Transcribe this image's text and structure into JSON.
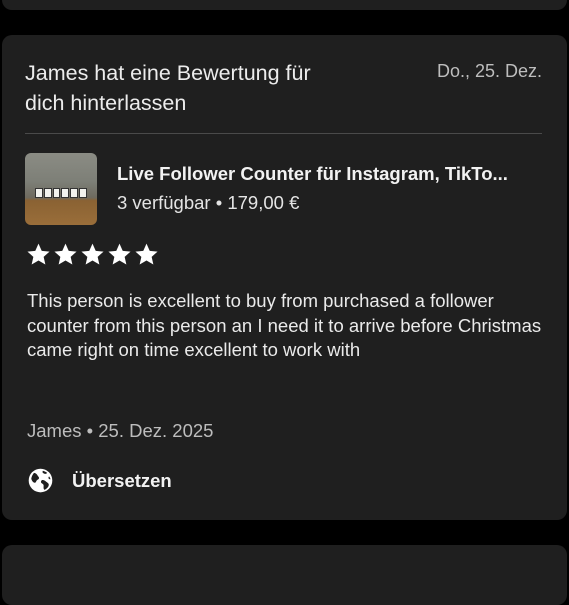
{
  "notification": {
    "title": "James hat eine Bewertung für dich hinterlassen",
    "date": "Do., 25. Dez."
  },
  "product": {
    "title": "Live Follower Counter für Instagram, TikTo...",
    "availability": "3 verfügbar",
    "separator": "•",
    "price": "179,00 €"
  },
  "review": {
    "rating": 5,
    "max_rating": 5,
    "text": "This person is excellent to buy from purchased a follower counter from this person an I need it to arrive before Christmas came right on time excellent to work with",
    "author": "James",
    "separator": "•",
    "date": "25. Dez. 2025"
  },
  "actions": {
    "translate_label": "Übersetzen",
    "translate_icon": "globe-icon"
  },
  "colors": {
    "background": "#000000",
    "card": "#1f1f1f",
    "text_primary": "#f2f2f2",
    "text_secondary": "#bdbdbd"
  }
}
